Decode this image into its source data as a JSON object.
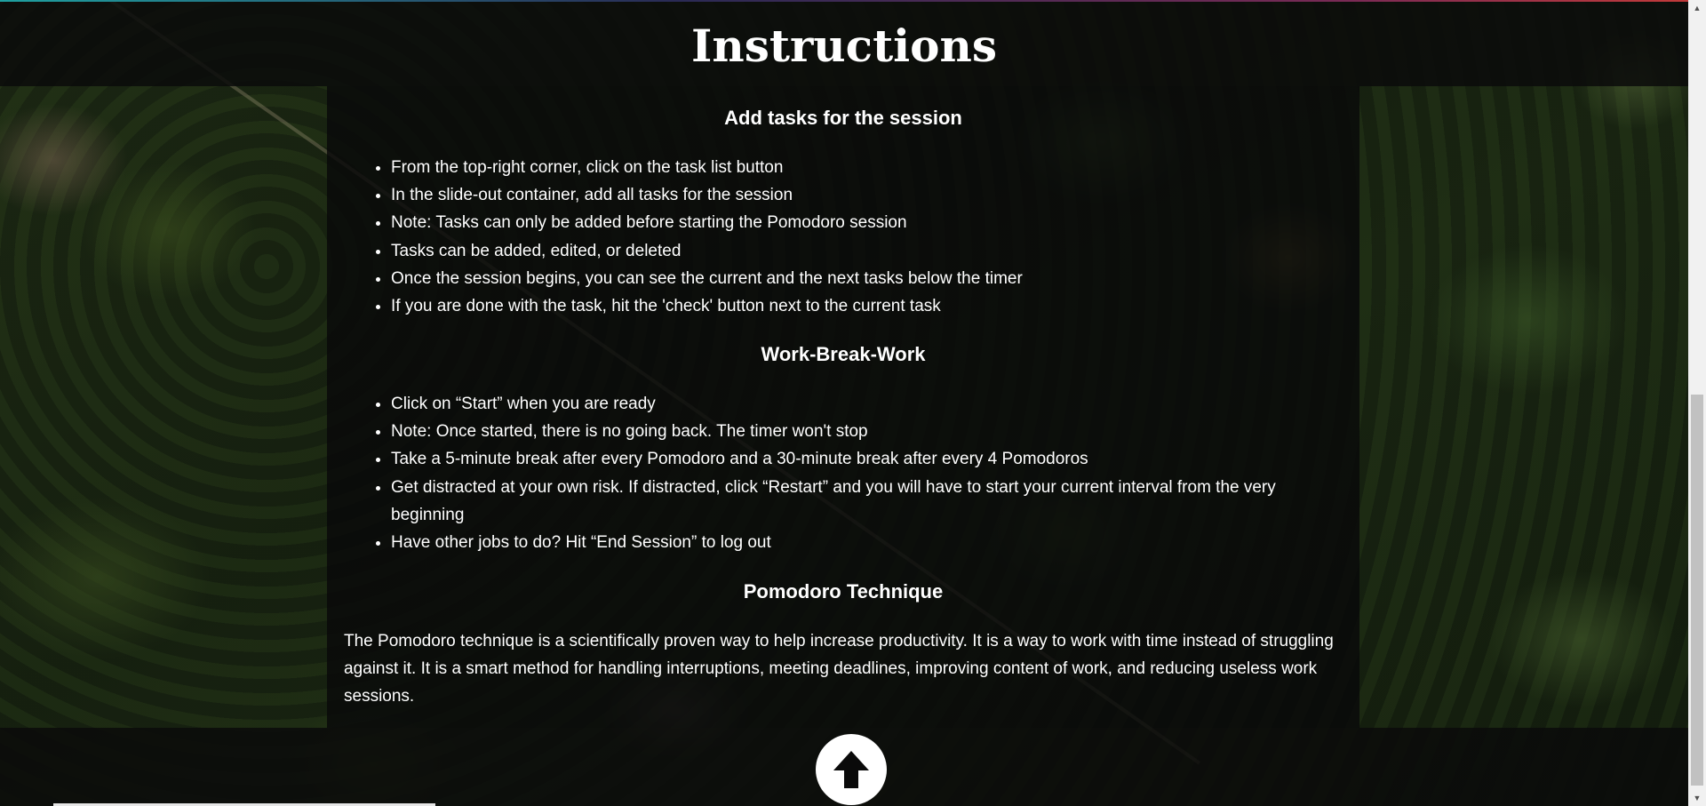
{
  "page": {
    "title": "Instructions"
  },
  "sections": [
    {
      "heading": "Add tasks for the session",
      "items": [
        "From the top-right corner, click on the task list button",
        "In the slide-out container, add all tasks for the session",
        "Note: Tasks can only be added before starting the Pomodoro session",
        "Tasks can be added, edited, or deleted",
        "Once the session begins, you can see the current and the next tasks below the timer",
        "If you are done with the task, hit the 'check' button next to the current task"
      ]
    },
    {
      "heading": "Work-Break-Work",
      "items": [
        "Click on “Start” when you are ready",
        "Note: Once started, there is no going back. The timer won't stop",
        "Take a 5-minute break after every Pomodoro and a 30-minute break after every 4 Pomodoros",
        "Get distracted at your own risk. If distracted, click “Restart” and you will have to start your current interval from the very beginning",
        "Have other jobs to do? Hit “End Session” to log out"
      ]
    },
    {
      "heading": "Pomodoro Technique",
      "paragraph": "The Pomodoro technique is a scientifically proven way to help increase productivity. It is a way to work with time instead of struggling against it. It is a smart method for handling interruptions, meeting deadlines, improving content of work, and reducing useless work sessions."
    }
  ],
  "scroll_top_button": {
    "icon": "arrow-up-icon"
  },
  "scrollbar": {
    "up_arrow": "▲",
    "down_arrow": "▼"
  },
  "colors": {
    "overlay": "#0a0a0a",
    "text": "#ffffff",
    "button_bg": "#ffffff",
    "icon": "#0a0a0a"
  }
}
